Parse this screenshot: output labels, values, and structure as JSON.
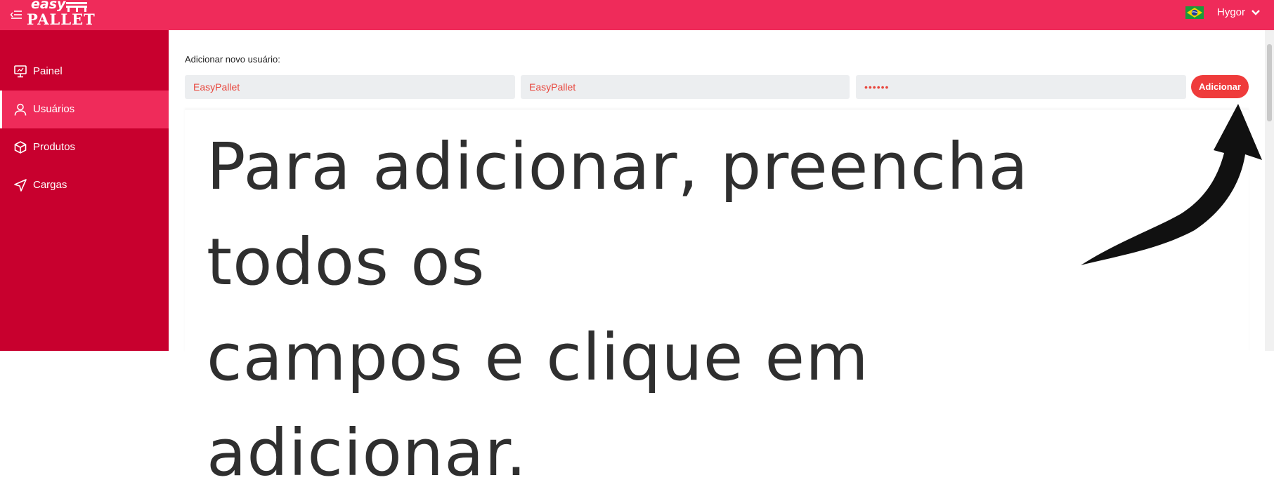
{
  "header": {
    "logo_top": "easy",
    "logo_bottom": "PALLET",
    "user_name": "Hygor",
    "icons": {
      "menu": "menu-toggle-icon",
      "flag": "brazil-flag-icon",
      "dropdown": "chevron-down-icon"
    }
  },
  "sidebar": {
    "items": [
      {
        "label": "Painel",
        "icon": "monitor-icon"
      },
      {
        "label": "Usuários",
        "icon": "user-icon"
      },
      {
        "label": "Produtos",
        "icon": "box-icon"
      },
      {
        "label": "Cargas",
        "icon": "send-icon"
      }
    ],
    "active_index": 1
  },
  "form": {
    "label": "Adicionar novo usuário:",
    "field1_value": "EasyPallet",
    "field2_value": "EasyPallet",
    "field3_value": "••••••",
    "submit_label": "Adicionar"
  },
  "overlay": {
    "line1": "Para adicionar, preencha todos os",
    "line2": "campos e clique em adicionar."
  },
  "colors": {
    "topbar": "#ef2b5a",
    "sidebar": "#c8002e",
    "active_item": "#ef2b5a",
    "accent_button": "#ef3b3b",
    "input_text": "#e8473d"
  }
}
